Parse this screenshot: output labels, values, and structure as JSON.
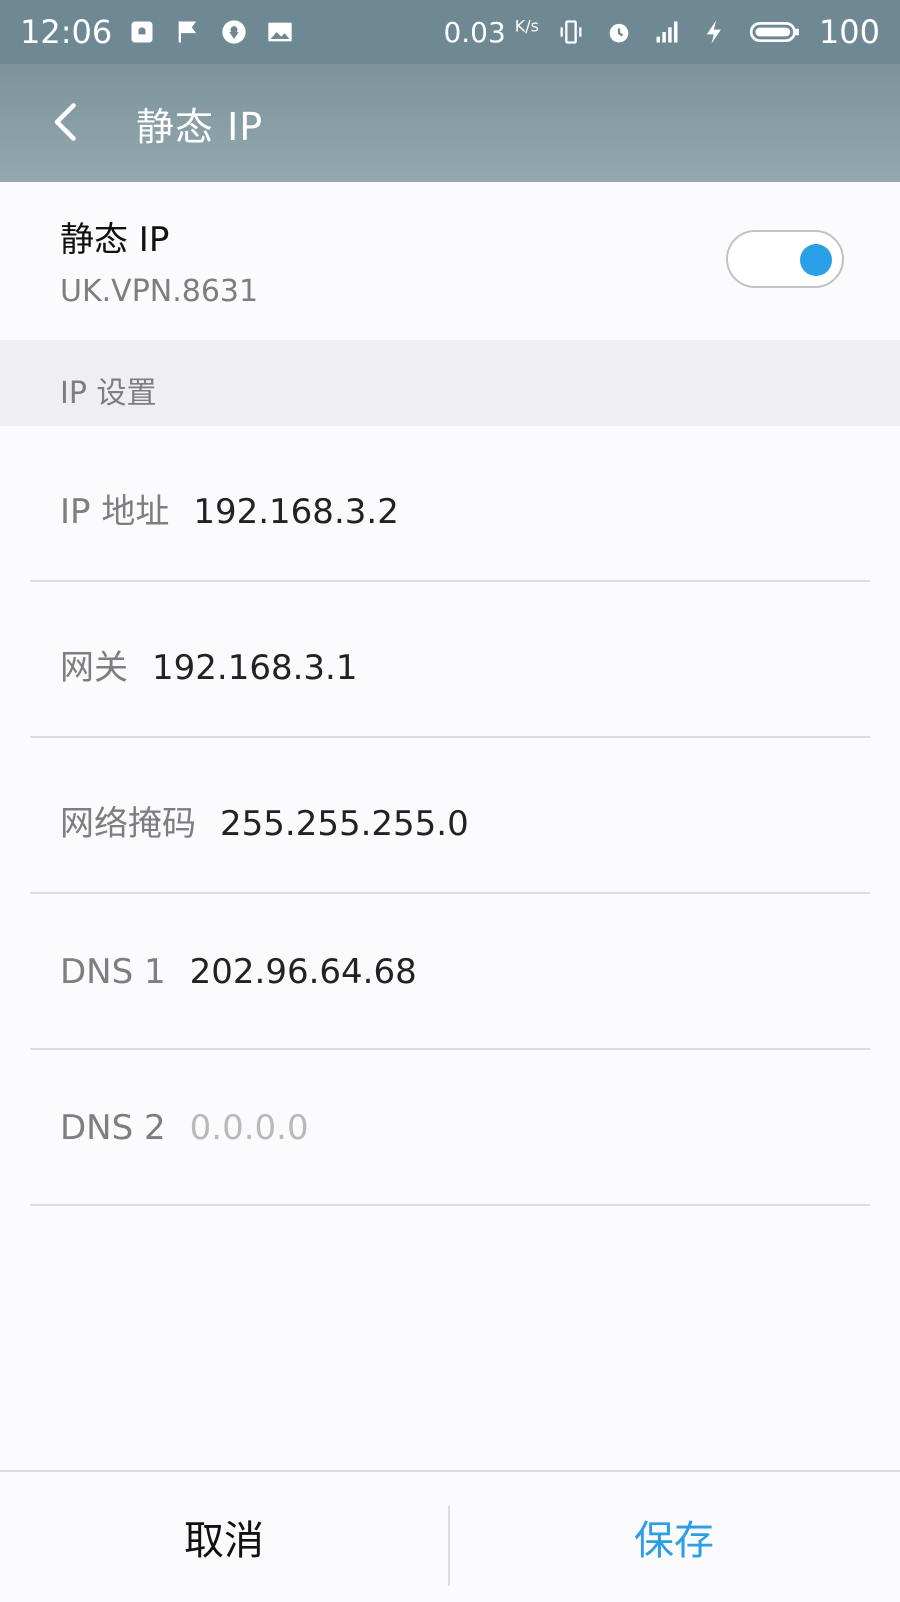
{
  "status_bar": {
    "time": "12:06",
    "left_icons": [
      "notification-icon",
      "flag-icon",
      "location-icon",
      "image-icon"
    ],
    "speed_value": "0.03",
    "speed_unit": "K/s",
    "battery": "100"
  },
  "app_bar": {
    "title": "静态 IP"
  },
  "static_ip": {
    "title": "静态 IP",
    "network": "UK.VPN.8631",
    "enabled": true,
    "accent_color": "#2a9fe8"
  },
  "ip_settings": {
    "header": "IP 设置",
    "fields": [
      {
        "label": "IP 地址",
        "value": "192.168.3.2"
      },
      {
        "label": "网关",
        "value": "192.168.3.1"
      },
      {
        "label": "网络掩码",
        "value": "255.255.255.0"
      },
      {
        "label": "DNS 1",
        "value": "202.96.64.68"
      },
      {
        "label": "DNS 2",
        "placeholder": "0.0.0.0"
      }
    ]
  },
  "actions": {
    "cancel_label": "取消",
    "save_label": "保存"
  }
}
